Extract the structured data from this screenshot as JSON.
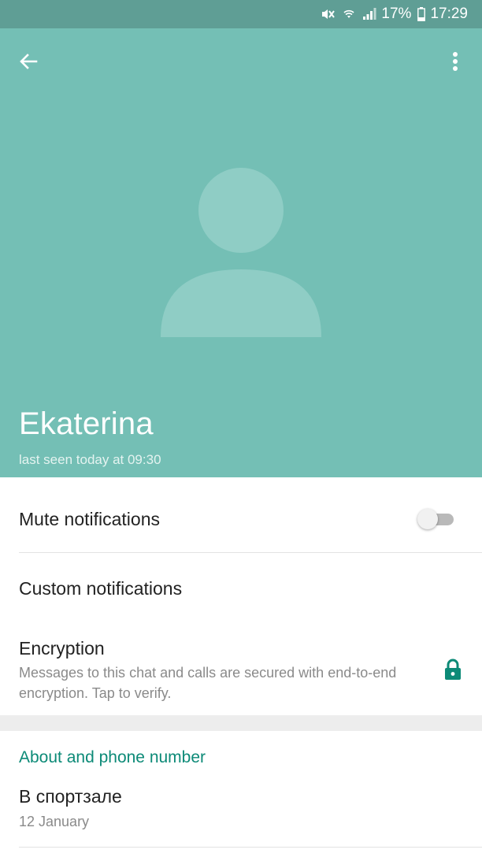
{
  "status_bar": {
    "icons": [
      "mute-icon",
      "wifi-icon",
      "signal-icon",
      "battery-icon"
    ],
    "battery": "17%",
    "time": "17:29"
  },
  "header": {
    "back_icon": "arrow-left-icon",
    "more_icon": "more-vert-icon",
    "avatar_icon": "default-avatar-icon",
    "name": "Ekaterina",
    "last_seen": "last seen today at 09:30",
    "bg_color": "#74bfb5"
  },
  "settings": {
    "mute_label": "Mute notifications",
    "mute_enabled": false,
    "custom_label": "Custom notifications",
    "encryption_label": "Encryption",
    "encryption_desc": "Messages to this chat and calls are secured with end-to-end encryption. Tap to verify.",
    "encryption_icon": "lock-icon"
  },
  "about": {
    "title": "About and phone number",
    "status": "В спортзале",
    "date": "12 January"
  },
  "colors": {
    "accent": "#0c8a77",
    "header": "#74bfb5",
    "status_bar": "#5f9e95"
  }
}
